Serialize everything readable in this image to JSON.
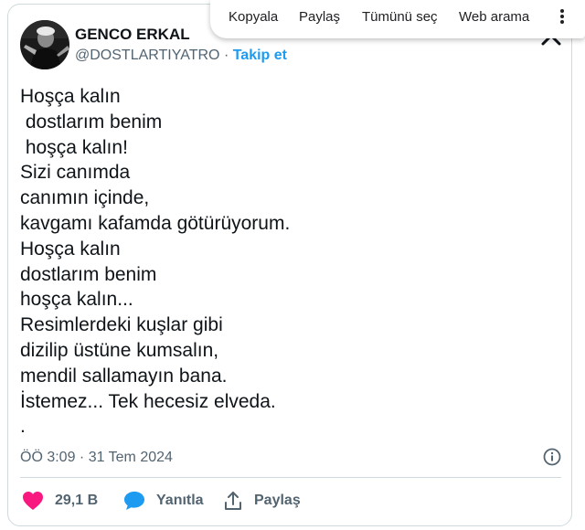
{
  "context_menu": {
    "items": [
      "Kopyala",
      "Paylaş",
      "Tümünü seç",
      "Web arama"
    ],
    "more_icon": "vertical-ellipsis-icon"
  },
  "author": {
    "display_name": "GENCO ERKAL",
    "handle": "@DOSTLARTIYATRO",
    "separator": "·",
    "follow_label": "Takip et",
    "avatar_icon": "profile-photo"
  },
  "tweet": {
    "lines": [
      "Hoşça kalın",
      " dostlarım benim",
      " hoşça kalın!",
      "Sizi canımda",
      "canımın içinde,",
      "kavgamı kafamda götürüyorum.",
      "Hoşça kalın",
      "dostlarım benim",
      "hoşça kalın...",
      "Resimlerdeki kuşlar gibi",
      "dizilip üstüne kumsalın,",
      "mendil sallamayın bana.",
      "İstemez... Tek hecesiz elveda.",
      "."
    ],
    "timestamp": "ÖÖ 3:09 · 31 Tem 2024"
  },
  "actions": {
    "like": {
      "count": "29,1 B",
      "icon": "heart-icon",
      "color": "#f91880"
    },
    "reply": {
      "label": "Yanıtla",
      "icon": "speech-bubble-icon",
      "color": "#1d9bf0"
    },
    "share": {
      "label": "Paylaş",
      "icon": "share-icon"
    }
  },
  "colors": {
    "accent": "#1d9bf0",
    "text_primary": "#0f1419",
    "text_secondary": "#536471",
    "border": "#cfd9de"
  }
}
